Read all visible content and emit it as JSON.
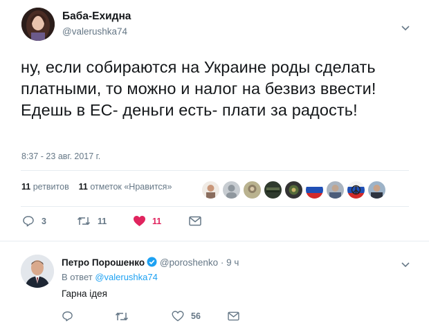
{
  "tweet": {
    "author_name": "Баба-Ехидна",
    "author_handle": "@valerushka74",
    "text": "ну, если собираются на Украине роды сделать платными, то можно и налог на безвиз ввести! Едешь в ЕС- деньги есть- плати за радость!",
    "timestamp": "8:37 - 23 авг. 2017 г.",
    "retweets_count": "11",
    "retweets_label": "ретвитов",
    "likes_count": "11",
    "likes_label": "отметок «Нравится»",
    "liker_avatars_count": 10,
    "actions": {
      "reply_count": "3",
      "retweet_count": "11",
      "like_count": "11"
    },
    "colors": {
      "like_active": "#e0245e",
      "muted": "#657786"
    }
  },
  "reply": {
    "author_name": "Петро Порошенко",
    "author_handle": "@poroshenko",
    "time": "· 9 ч",
    "reply_to_label": "В ответ",
    "reply_to_handle": "@valerushka74",
    "text": "Гарна ідея",
    "actions": {
      "like_count": "56"
    },
    "colors": {
      "link": "#1da1f2",
      "verified": "#1da1f2"
    }
  }
}
